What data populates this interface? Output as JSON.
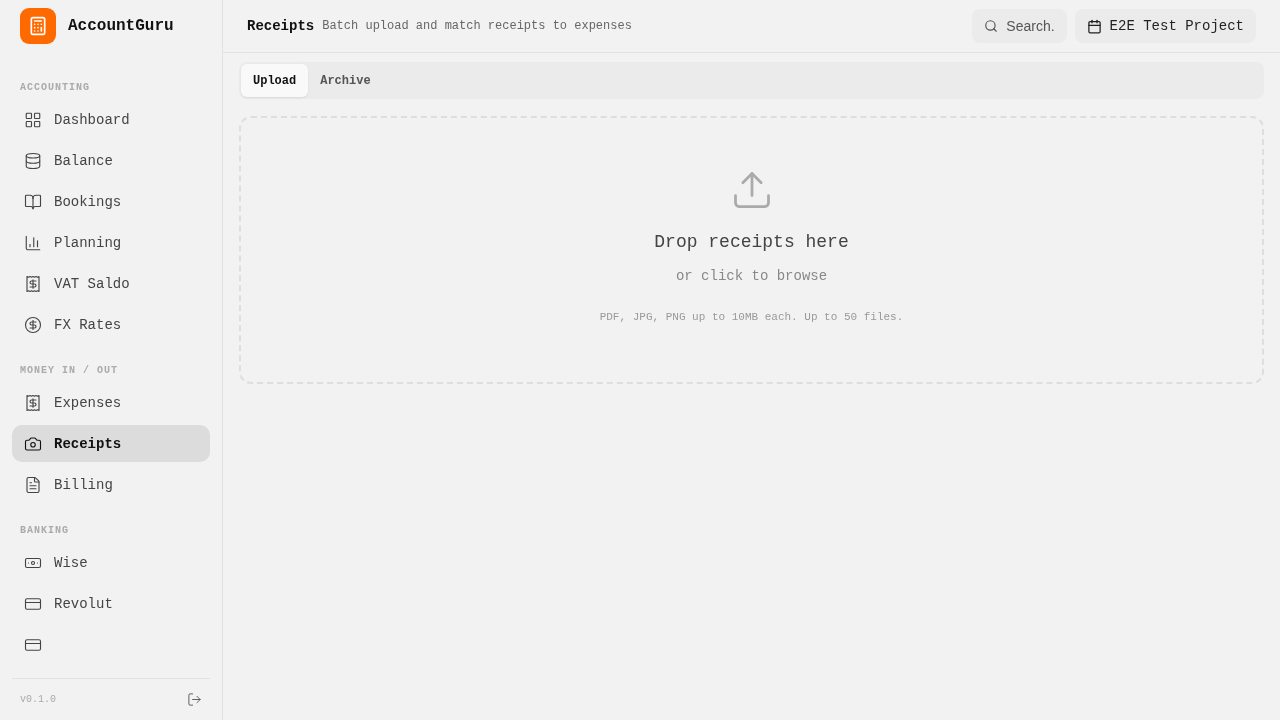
{
  "app": {
    "name": "AccountGuru"
  },
  "sidebar": {
    "sections": [
      {
        "title": "ACCOUNTING",
        "items": [
          {
            "label": "Dashboard",
            "selected": false
          },
          {
            "label": "Balance",
            "selected": false
          },
          {
            "label": "Bookings",
            "selected": false
          },
          {
            "label": "Planning",
            "selected": false
          },
          {
            "label": "VAT Saldo",
            "selected": false
          },
          {
            "label": "FX Rates",
            "selected": false
          }
        ]
      },
      {
        "title": "MONEY IN / OUT",
        "items": [
          {
            "label": "Expenses",
            "selected": false
          },
          {
            "label": "Receipts",
            "selected": true
          },
          {
            "label": "Billing",
            "selected": false
          }
        ]
      },
      {
        "title": "BANKING",
        "items": [
          {
            "label": "Wise",
            "selected": false
          },
          {
            "label": "Revolut",
            "selected": false
          },
          {
            "selected": false
          }
        ]
      }
    ],
    "version": "v0.1.0"
  },
  "header": {
    "title": "Receipts",
    "subtitle": "Batch upload and match receipts to expenses",
    "search": {
      "placeholder": "Search."
    },
    "project": "E2E Test Project"
  },
  "tabs": [
    {
      "label": "Upload",
      "selected": true
    },
    {
      "label": "Archive",
      "selected": false
    }
  ],
  "dropzone": {
    "title": "Drop receipts here",
    "subtitle": "or click to browse",
    "hint": "PDF, JPG, PNG up to 10MB each. Up to 50 files."
  }
}
